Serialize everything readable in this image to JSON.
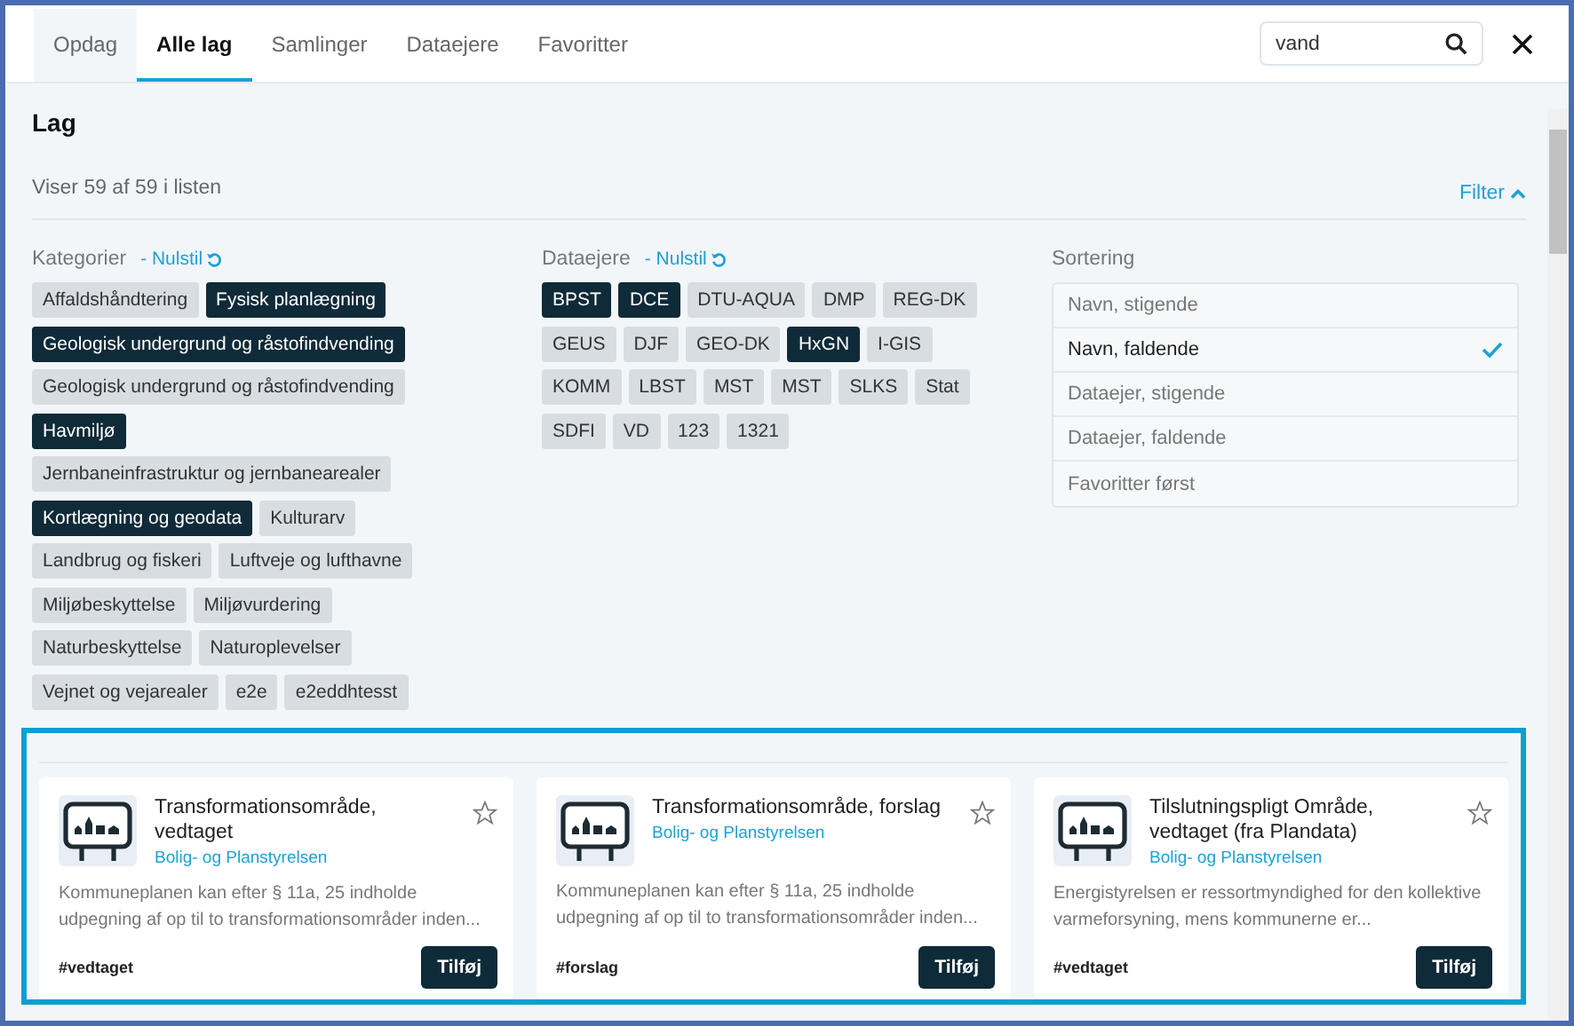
{
  "tabs": [
    {
      "label": "Opdag",
      "selected": false
    },
    {
      "label": "Alle lag",
      "selected": true
    },
    {
      "label": "Samlinger",
      "selected": false
    },
    {
      "label": "Dataejere",
      "selected": false
    },
    {
      "label": "Favoritter",
      "selected": false
    }
  ],
  "search": {
    "value": "vand"
  },
  "title": "Lag",
  "count": "Viser 59 af 59 i listen",
  "filter_toggle": {
    "label": "Filter",
    "expanded": true
  },
  "categories": {
    "label": "Kategorier",
    "reset": "- Nulstil",
    "tags": [
      {
        "label": "Affaldshåndtering",
        "selected": false
      },
      {
        "label": "Fysisk planlægning",
        "selected": true
      },
      {
        "label": "Geologisk undergrund og råstofindvending",
        "selected": true
      },
      {
        "label": "Geologisk undergrund og råstofindvending",
        "selected": false
      },
      {
        "label": "Havmiljø",
        "selected": true
      },
      {
        "label": "Jernbaneinfrastruktur og jernbanearealer",
        "selected": false
      },
      {
        "label": "Kortlægning og geodata",
        "selected": true
      },
      {
        "label": "Kulturarv",
        "selected": false
      },
      {
        "label": "Landbrug og fiskeri",
        "selected": false
      },
      {
        "label": "Luftveje og lufthavne",
        "selected": false
      },
      {
        "label": "Miljøbeskyttelse",
        "selected": false
      },
      {
        "label": "Miljøvurdering",
        "selected": false
      },
      {
        "label": "Naturbeskyttelse",
        "selected": false
      },
      {
        "label": "Naturoplevelser",
        "selected": false
      },
      {
        "label": "Vejnet og vejarealer",
        "selected": false
      },
      {
        "label": "e2e",
        "selected": false
      },
      {
        "label": "e2eddhtesst",
        "selected": false
      }
    ]
  },
  "owners": {
    "label": "Dataejere",
    "reset": "- Nulstil",
    "tags": [
      {
        "label": "BPST",
        "selected": true
      },
      {
        "label": "DCE",
        "selected": true
      },
      {
        "label": "DTU-AQUA",
        "selected": false
      },
      {
        "label": "DMP",
        "selected": false
      },
      {
        "label": "REG-DK",
        "selected": false
      },
      {
        "label": "GEUS",
        "selected": false
      },
      {
        "label": "DJF",
        "selected": false
      },
      {
        "label": "GEO-DK",
        "selected": false
      },
      {
        "label": "HxGN",
        "selected": true
      },
      {
        "label": "I-GIS",
        "selected": false
      },
      {
        "label": "KOMM",
        "selected": false
      },
      {
        "label": "LBST",
        "selected": false
      },
      {
        "label": "MST",
        "selected": false
      },
      {
        "label": "MST",
        "selected": false
      },
      {
        "label": "SLKS",
        "selected": false
      },
      {
        "label": "Stat",
        "selected": false
      },
      {
        "label": "SDFI",
        "selected": false
      },
      {
        "label": "VD",
        "selected": false
      },
      {
        "label": "123",
        "selected": false
      },
      {
        "label": "1321",
        "selected": false
      }
    ]
  },
  "sorting": {
    "label": "Sortering",
    "options": [
      {
        "label": "Navn, stigende",
        "selected": false
      },
      {
        "label": "Navn, faldende",
        "selected": true
      },
      {
        "label": "Dataejer, stigende",
        "selected": false
      },
      {
        "label": "Dataejer, faldende",
        "selected": false
      },
      {
        "label": "Favoritter først",
        "selected": false
      }
    ]
  },
  "cards": [
    {
      "title": "Transformationsområde, vedtaget",
      "owner": "Bolig- og Planstyrelsen",
      "description": "Kommuneplanen kan efter § 11a, 25 indholde udpegning af op til to transformationsområder inden...",
      "tag": "#vedtaget",
      "button": "Tilføj",
      "favorite": false
    },
    {
      "title": "Transformationsområde, forslag",
      "owner": "Bolig- og Planstyrelsen",
      "description": "Kommuneplanen kan efter § 11a, 25 indholde udpegning af op til to transformationsområder inden...",
      "tag": "#forslag",
      "button": "Tilføj",
      "favorite": false
    },
    {
      "title": "Tilslutningspligt Område, vedtaget (fra Plandata)",
      "owner": "Bolig- og Planstyrelsen",
      "description": "Energistyrelsen er ressortmyndighed for den kollektive varmeforsyning, mens kommunerne er...",
      "tag": "#vedtaget",
      "button": "Tilføj",
      "favorite": false
    }
  ]
}
